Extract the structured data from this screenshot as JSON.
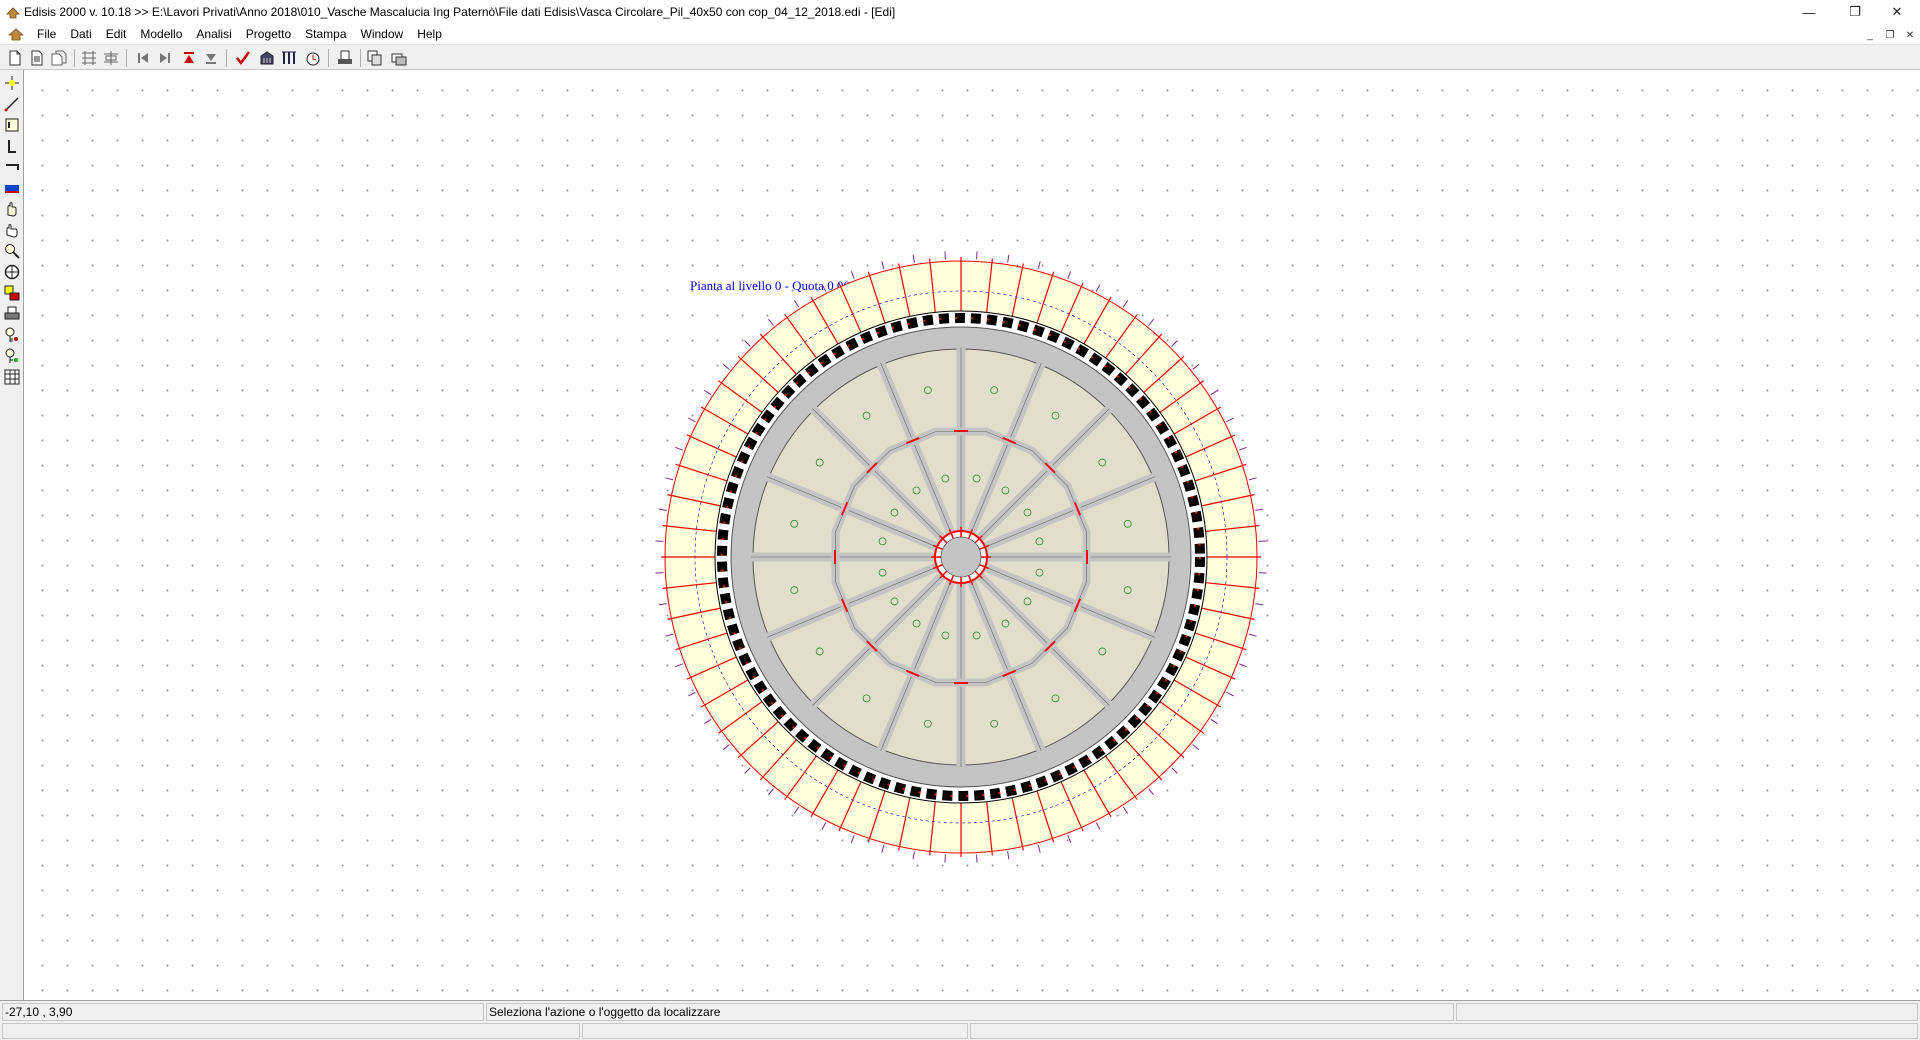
{
  "window": {
    "title": "Edisis 2000 v. 10.18 >> E:\\Lavori Privati\\Anno 2018\\010_Vasche Mascalucia Ing Paternò\\File dati Edisis\\Vasca Circolare_Pil_40x50 con cop_04_12_2018.edi - [Edi]",
    "controls": {
      "minimize": "—",
      "restore": "❐",
      "close": "✕"
    }
  },
  "menu": {
    "items": [
      "File",
      "Dati",
      "Edit",
      "Modello",
      "Analisi",
      "Progetto",
      "Stampa",
      "Window",
      "Help"
    ],
    "mdi_controls": {
      "minimize": "_",
      "restore": "❐",
      "close": "✕"
    }
  },
  "toolbar": {
    "buttons": [
      "new-file-icon",
      "open-file-icon",
      "copy-file-icon",
      "grid-icon",
      "grid-alt-icon",
      "first-icon",
      "last-icon",
      "up-red-icon",
      "down-icon",
      "check-icon",
      "building-icon",
      "columns-icon",
      "clock-icon",
      "print-preview-icon",
      "copy-icon",
      "layers-icon"
    ]
  },
  "left_toolbar": {
    "buttons": [
      "node-icon",
      "line-icon",
      "beam-icon",
      "column-icon",
      "wall-icon",
      "slab-icon",
      "hand-icon",
      "pan-icon",
      "zoom-icon",
      "target-icon",
      "layer-icon",
      "printer-icon",
      "key-icon",
      "key-alt-icon",
      "grid-table-icon"
    ]
  },
  "drawing": {
    "title": "Pianta al livello 0 - Quota 0.00 m.",
    "colors": {
      "outer_panel": "#ffffdc",
      "slab": "#e1dfcc",
      "beam": "#c4c4c4",
      "red": "#ff0000",
      "blue": "#0000cc",
      "purple": "#7a2a8a",
      "green": "#2a8a2a"
    }
  },
  "status": {
    "coordinates": "-27,10 , 3,90",
    "message": "Seleziona l'azione o l'oggetto da localizzare"
  }
}
